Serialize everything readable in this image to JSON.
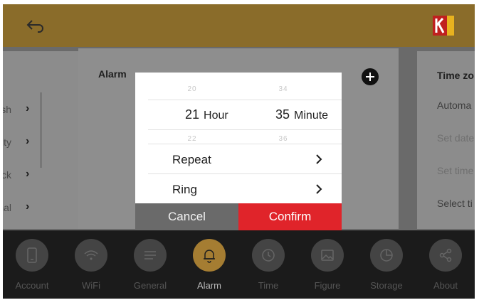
{
  "left_panel": {
    "items": [
      {
        "label": "lish"
      },
      {
        "label": "vity"
      },
      {
        "label": "ock"
      },
      {
        "label": "nal"
      }
    ]
  },
  "alarm_panel": {
    "title": "Alarm"
  },
  "right_panel": {
    "title": "Time zo",
    "items": [
      "Automa",
      "Set date",
      "Set time",
      "Select ti"
    ]
  },
  "dialog": {
    "hour": {
      "prev": "20",
      "value": "21",
      "unit": "Hour",
      "next": "22"
    },
    "minute": {
      "prev": "34",
      "value": "35",
      "unit": "Minute",
      "next": "36"
    },
    "repeat_label": "Repeat",
    "ring_label": "Ring",
    "cancel_label": "Cancel",
    "confirm_label": "Confirm"
  },
  "nav": [
    {
      "label": "Account",
      "icon": "phone-icon"
    },
    {
      "label": "WiFi",
      "icon": "wifi-icon"
    },
    {
      "label": "General",
      "icon": "list-icon"
    },
    {
      "label": "Alarm",
      "icon": "bell-icon",
      "active": true
    },
    {
      "label": "Time",
      "icon": "clock-icon"
    },
    {
      "label": "Figure",
      "icon": "image-icon"
    },
    {
      "label": "Storage",
      "icon": "pie-icon"
    },
    {
      "label": "About",
      "icon": "share-icon"
    }
  ],
  "colors": {
    "topbar": "#8a6c2a",
    "confirm": "#e0242a",
    "cancel": "#6a6a6a",
    "alarm_active": "#a57d32",
    "logo_red": "#c0201f"
  }
}
